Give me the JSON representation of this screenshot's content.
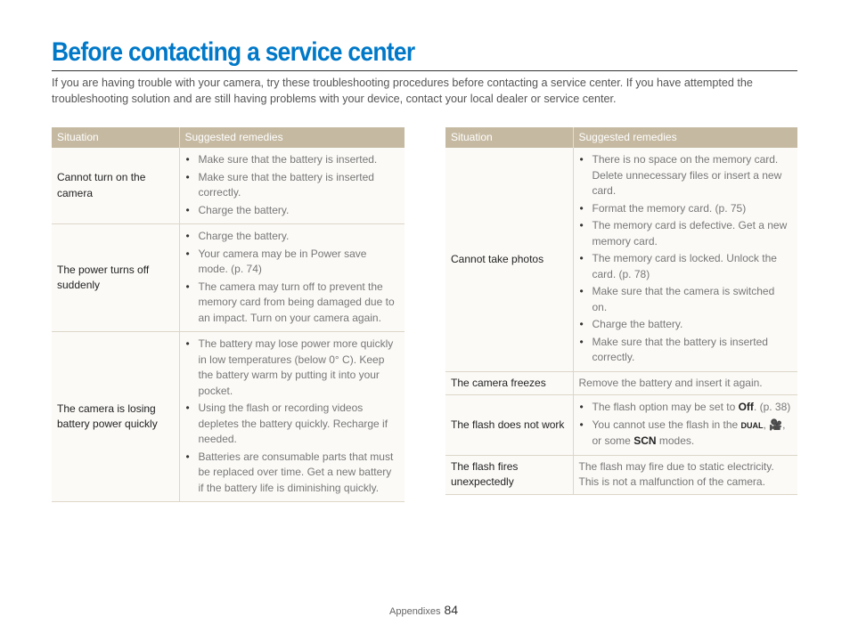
{
  "title": "Before contacting a service center",
  "intro": "If you are having trouble with your camera, try these troubleshooting procedures before contacting a service center. If you have attempted the troubleshooting solution and are still having problems with your device, contact your local dealer or service center.",
  "headers": {
    "situation": "Situation",
    "remedies": "Suggested remedies"
  },
  "left_table": [
    {
      "situation": "Cannot turn on the camera",
      "remedies": [
        "Make sure that the battery is inserted.",
        "Make sure that the battery is inserted correctly.",
        "Charge the battery."
      ]
    },
    {
      "situation": "The power turns off suddenly",
      "remedies": [
        "Charge the battery.",
        "Your camera may be in Power save mode. (p. 74)",
        "The camera may turn off to prevent the memory card from being damaged due to an impact. Turn on your camera again."
      ]
    },
    {
      "situation": "The camera is losing battery power quickly",
      "remedies": [
        "The battery may lose power more quickly in low temperatures (below 0° C). Keep the battery warm by putting it into your pocket.",
        "Using the flash or recording videos depletes the battery quickly. Recharge if needed.",
        "Batteries are consumable parts that must be replaced over time. Get a new battery if the battery life is diminishing quickly."
      ]
    }
  ],
  "right_table": [
    {
      "situation": "Cannot take photos",
      "remedies": [
        "There is no space on the memory card. Delete unnecessary files or insert a new card.",
        "Format the memory card. (p. 75)",
        "The memory card is defective. Get a new memory card.",
        "The memory card is locked. Unlock the card. (p. 78)",
        "Make sure that the camera is switched on.",
        "Charge the battery.",
        "Make sure that the battery is inserted correctly."
      ]
    },
    {
      "situation": "The camera freezes",
      "text": "Remove the battery and insert it again."
    },
    {
      "situation": "The flash does not work",
      "flash1": "The flash option may be set to ",
      "flash1_bold": "Off",
      "flash1_end": ". (p. 38)",
      "flash2a": "You cannot use the flash in the ",
      "flash2_icon1": "DUAL",
      "flash2b": ", ",
      "flash2c": ", or some ",
      "flash2_scn": "SCN",
      "flash2d": " modes."
    },
    {
      "situation": "The flash fires unexpectedly",
      "text": "The flash may fire due to static electricity. This is not a malfunction of the camera."
    }
  ],
  "footer": {
    "section": "Appendixes",
    "page": "84"
  }
}
